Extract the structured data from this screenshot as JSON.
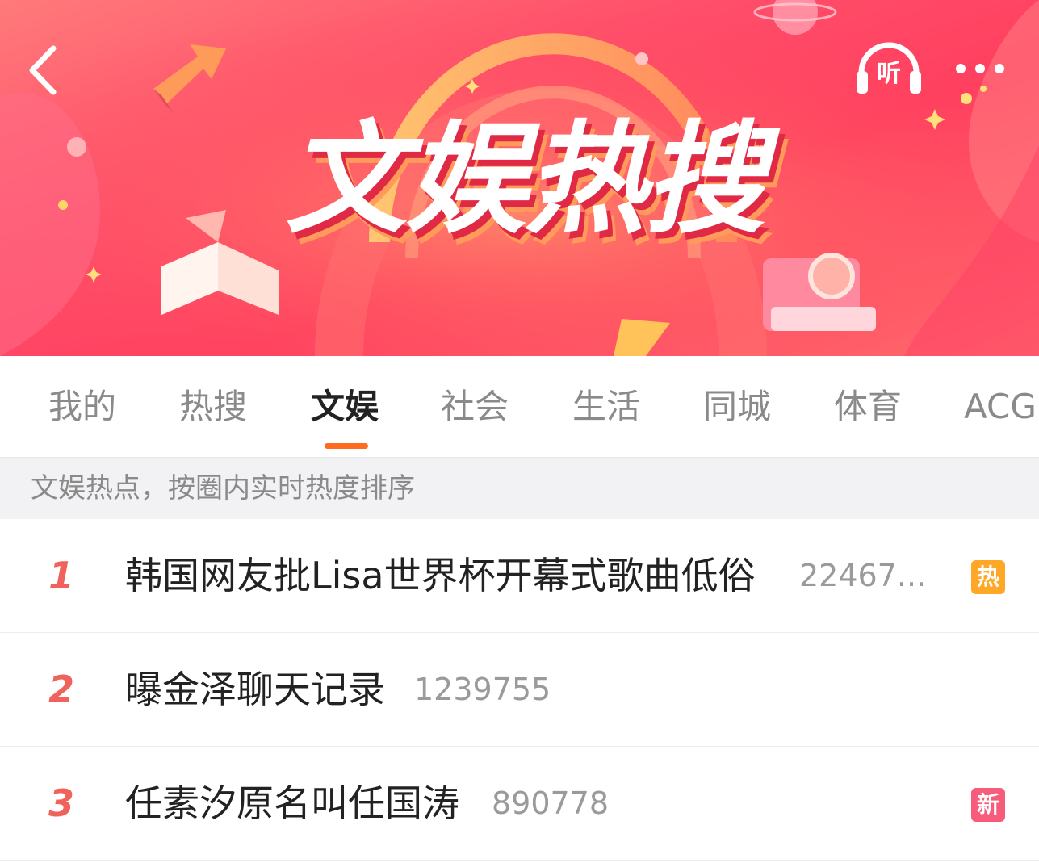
{
  "header": {
    "banner_title": "文娱热搜",
    "listen_label": "听"
  },
  "icons": {
    "back": "chevron-left-icon",
    "listen": "headphones-icon",
    "more": "more-dots-icon"
  },
  "tabs": [
    {
      "label": "我的",
      "active": false
    },
    {
      "label": "热搜",
      "active": false
    },
    {
      "label": "文娱",
      "active": true
    },
    {
      "label": "社会",
      "active": false
    },
    {
      "label": "生活",
      "active": false
    },
    {
      "label": "同城",
      "active": false
    },
    {
      "label": "体育",
      "active": false
    },
    {
      "label": "ACG",
      "active": false
    }
  ],
  "subheader": "文娱热点，按圈内实时热度排序",
  "items": [
    {
      "rank": "1",
      "title": "韩国网友批Lisa世界杯开幕式歌曲低俗",
      "count": "22467...",
      "badge": "热"
    },
    {
      "rank": "2",
      "title": "曝金泽聊天记录",
      "count": "1239755",
      "badge": ""
    },
    {
      "rank": "3",
      "title": "任素汐原名叫任国涛",
      "count": "890778",
      "badge": "新"
    }
  ],
  "colors": {
    "accent": "#ff6b1f",
    "rank": "#f0625c",
    "badge_hot": "#ffa726",
    "badge_new": "#f75d7a",
    "banner": "#ff4f6a"
  }
}
